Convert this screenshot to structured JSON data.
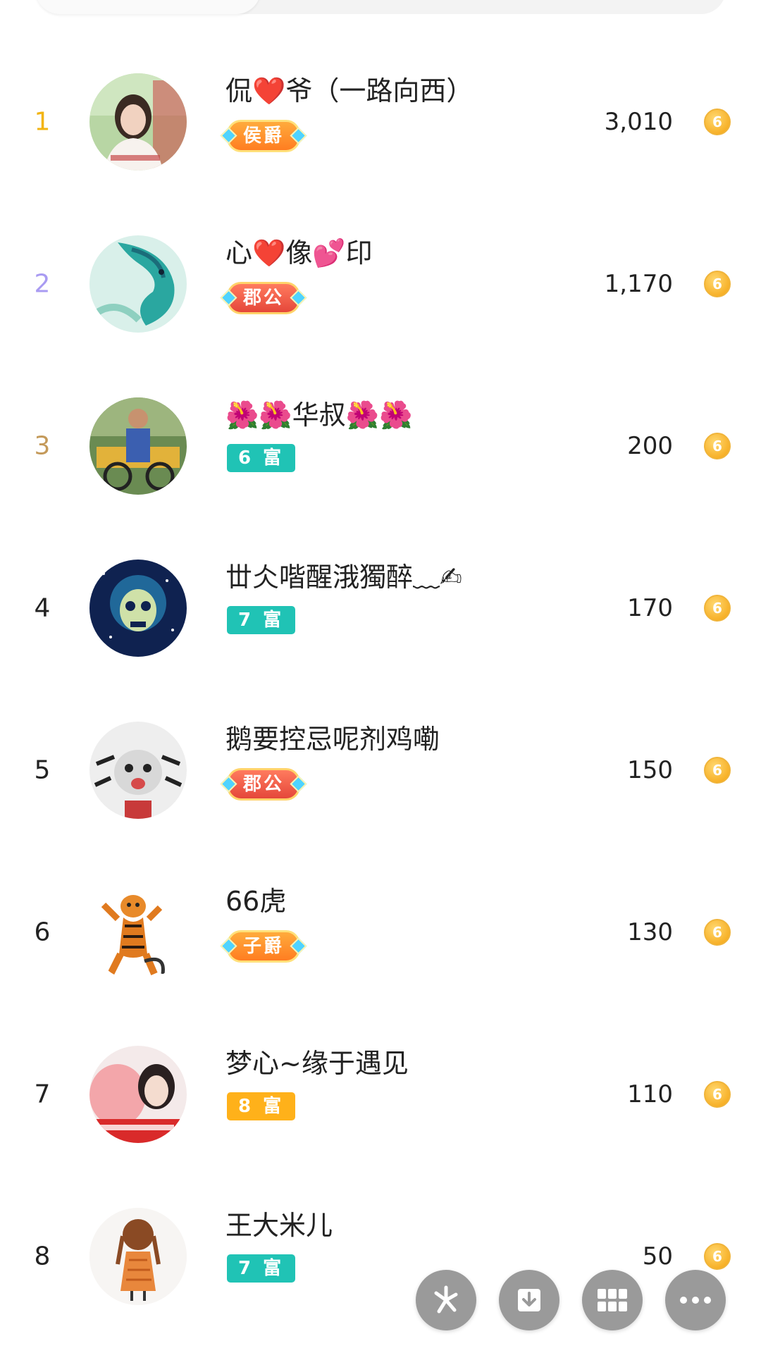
{
  "leaderboard": [
    {
      "rank": "1",
      "rank_color": "#f2b413",
      "name": "侃❤️爷（一路向西）",
      "badge": "侯爵",
      "badge_style": "noble-orange-red",
      "score": "3,010"
    },
    {
      "rank": "2",
      "rank_color": "#a99bf2",
      "name": "心❤️像💕印",
      "badge": "郡公",
      "badge_style": "noble-red",
      "score": "1,170"
    },
    {
      "rank": "3",
      "rank_color": "#c49a5a",
      "name": "🌺🌺华叔🌺🌺",
      "badge": "6 富",
      "badge_style": "rich-teal",
      "score": "200"
    },
    {
      "rank": "4",
      "rank_color": "#222222",
      "name": "丗仌喈醒涐獨醉﹏✍",
      "badge": "7 富",
      "badge_style": "rich-teal",
      "score": "170"
    },
    {
      "rank": "5",
      "rank_color": "#222222",
      "name": "鹅要控忌呢剂鸡嘞",
      "badge": "郡公",
      "badge_style": "noble-red",
      "score": "150"
    },
    {
      "rank": "6",
      "rank_color": "#222222",
      "name": "66虎",
      "badge": "子爵",
      "badge_style": "noble-orange",
      "score": "130"
    },
    {
      "rank": "7",
      "rank_color": "#222222",
      "name": "梦心~缘于遇见",
      "badge": "8 富",
      "badge_style": "rich-orange",
      "score": "110"
    },
    {
      "rank": "8",
      "rank_color": "#222222",
      "name": "王大米儿",
      "badge": "7 富",
      "badge_style": "rich-teal",
      "score": "50"
    }
  ],
  "coin_icon": {
    "name": "gold-coin-icon",
    "glyph": "6"
  },
  "floating_buttons": [
    {
      "name": "share-pinwheel-icon"
    },
    {
      "name": "download-icon"
    },
    {
      "name": "grid-menu-icon"
    },
    {
      "name": "more-dots-icon"
    }
  ],
  "colors": {
    "teal": "#20c3b5",
    "orange": "#ffb11a",
    "noble_red": "#e5473a",
    "fab_gray": "#9a9a9a"
  }
}
